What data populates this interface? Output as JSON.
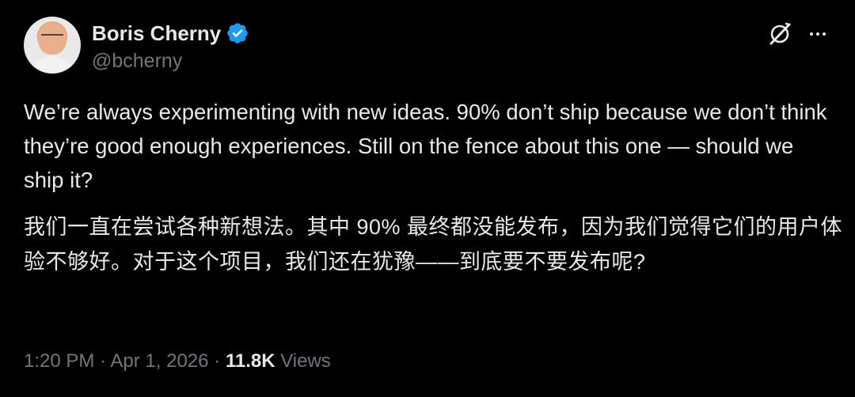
{
  "author": {
    "display_name": "Boris Cherny",
    "handle": "@bcherny",
    "verified_color": "#1d9bf0",
    "avatar_icon": "avatar-photo"
  },
  "actions": {
    "grok_icon": "grok-icon",
    "more_icon": "more-icon"
  },
  "tweet": {
    "text_en": "We’re always experimenting with new ideas. 90% don’t ship because we don’t think they’re good enough experiences. Still on the fence about this one — should we ship it?",
    "text_zh": "我们一直在尝试各种新想法。其中 90% 最终都没能发布，因为我们觉得它们的用户体验不够好。对于这个项目，我们还在犹豫——到底要不要发布呢?"
  },
  "meta": {
    "time": "1:20 PM",
    "sep1": " · ",
    "date": "Apr 1, 2026",
    "sep2": " · ",
    "views_count": "11.8K",
    "views_label": " Views"
  },
  "colors": {
    "background": "#000000",
    "text_primary": "#e7e9ea",
    "text_secondary": "#71767b",
    "accent": "#1d9bf0"
  }
}
